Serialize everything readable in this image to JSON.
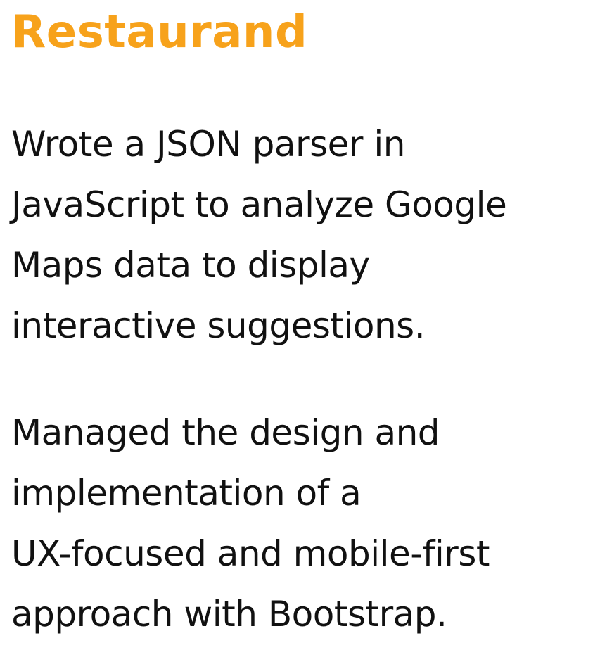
{
  "title": "Restaurand",
  "colors": {
    "title": "#F7A21B",
    "text": "#111111",
    "background": "#FFFFFF"
  },
  "paragraphs": [
    {
      "lines": [
        "Wrote a JSON parser in",
        "JavaScript to analyze Google",
        "Maps data to display",
        "interactive suggestions."
      ]
    },
    {
      "lines": [
        "Managed the design and",
        "implementation of a",
        "UX-focused and mobile-first",
        "approach with Bootstrap."
      ]
    }
  ]
}
